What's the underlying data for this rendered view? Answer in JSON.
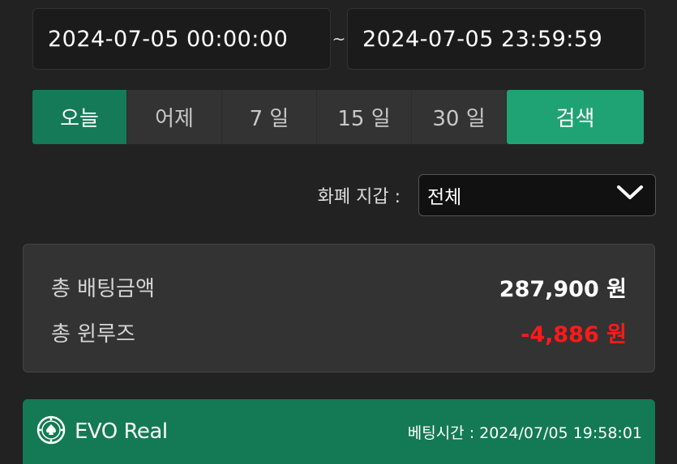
{
  "date_range": {
    "start": "2024-07-05 00:00:00",
    "separator": "~",
    "end": "2024-07-05 23:59:59"
  },
  "quick_range": {
    "buttons": [
      "오늘",
      "어제",
      "7 일",
      "15 일",
      "30 일"
    ],
    "active_index": 0,
    "search_label": "검색"
  },
  "currency": {
    "label": "화폐 지갑 :",
    "selected": "전체",
    "chevron_icon": "chevron-down-icon"
  },
  "summary": {
    "total_bet_label": "총 배팅금액",
    "total_bet_value": "287,900 원",
    "total_winloss_label": "총 윈루즈",
    "total_winloss_value": "-4,886 원"
  },
  "bet_item": {
    "game_icon": "poker-chip-icon",
    "game_name": "EVO Real",
    "time_label": "베팅시간 :",
    "time_value": "2024/07/05 19:58:01"
  },
  "colors": {
    "accent_active": "#157a57",
    "search_button": "#1fa374",
    "negative": "#ff1a1a",
    "card_header": "#137a55"
  }
}
